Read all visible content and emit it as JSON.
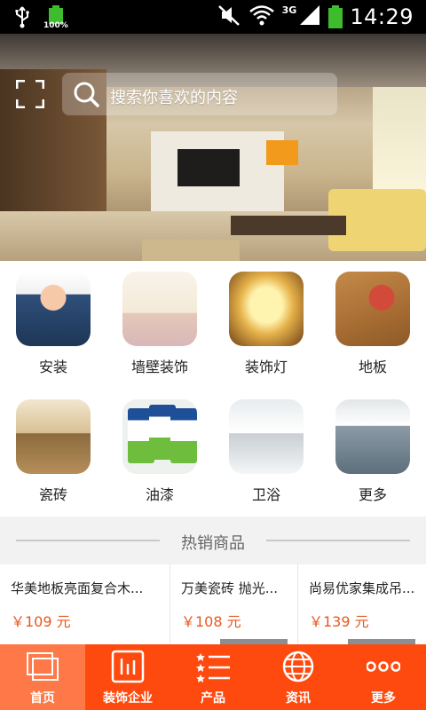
{
  "status_bar": {
    "battery_small_label": "100%",
    "network_type": "3G",
    "time": "14:29"
  },
  "banner": {
    "search_placeholder": "搜索你喜欢的内容",
    "slide_count": 5,
    "active_slide": 2
  },
  "categories": [
    {
      "label": "安装",
      "icon": "installers-thumbnail"
    },
    {
      "label": "墙壁装饰",
      "icon": "wall-decor-thumbnail"
    },
    {
      "label": "装饰灯",
      "icon": "decor-lamp-thumbnail"
    },
    {
      "label": "地板",
      "icon": "floor-thumbnail"
    },
    {
      "label": "瓷砖",
      "icon": "tile-thumbnail"
    },
    {
      "label": "油漆",
      "icon": "paint-thumbnail"
    },
    {
      "label": "卫浴",
      "icon": "bathroom-thumbnail"
    },
    {
      "label": "更多",
      "icon": "more-thumbnail"
    }
  ],
  "hot_section": {
    "title": "热销商品"
  },
  "products": [
    {
      "name": "华美地板亮面复合木...",
      "price": "￥109 元"
    },
    {
      "name": "万美瓷砖 抛光...",
      "price": "￥108 元"
    },
    {
      "name": "尚易优家集成吊...",
      "price": "￥139 元"
    }
  ],
  "bottom_nav": {
    "items": [
      {
        "label": "首页",
        "icon": "home-icon"
      },
      {
        "label": "装饰企业",
        "icon": "enterprise-icon"
      },
      {
        "label": "产品",
        "icon": "product-list-icon"
      },
      {
        "label": "资讯",
        "icon": "globe-icon"
      },
      {
        "label": "更多",
        "icon": "more-dots-icon"
      }
    ],
    "active_index": 0
  },
  "colors": {
    "accent": "#ff4a0f",
    "nav_active": "#ff7848",
    "price": "#e8571f",
    "battery": "#3dbd2d"
  }
}
